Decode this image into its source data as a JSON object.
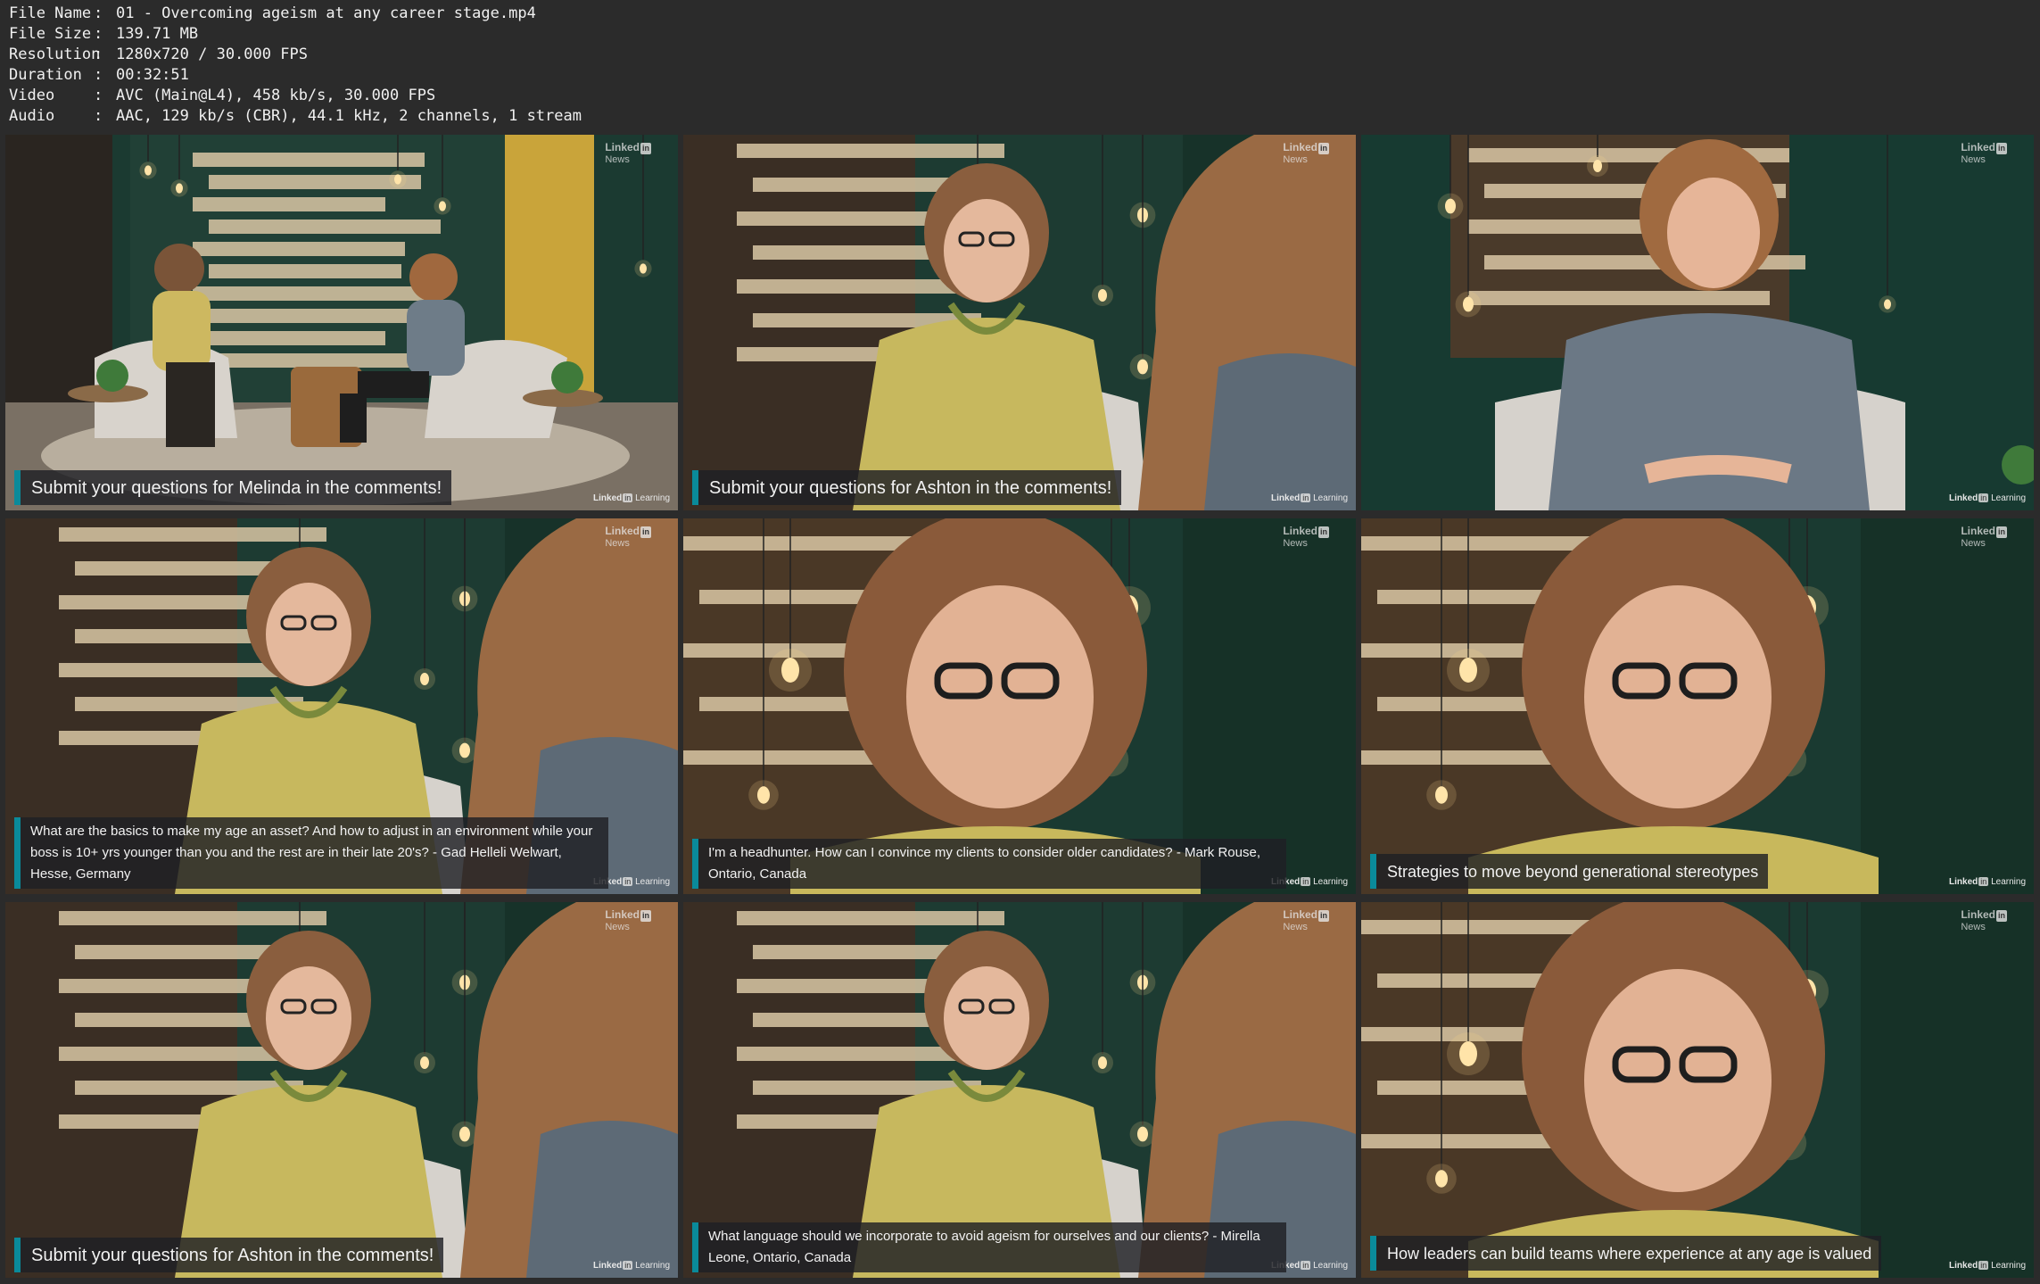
{
  "file_info": [
    {
      "key": "File Name",
      "value": "01 - Overcoming ageism at any career stage.mp4"
    },
    {
      "key": "File Size",
      "value": "139.71 MB"
    },
    {
      "key": "Resolution",
      "value": "1280x720 / 30.000 FPS"
    },
    {
      "key": "Duration",
      "value": "00:32:51"
    },
    {
      "key": "Video",
      "value": "AVC (Main@L4), 458 kb/s, 30.000 FPS"
    },
    {
      "key": "Audio",
      "value": "AAC, 129 kb/s (CBR), 44.1 kHz, 2 channels, 1 stream"
    }
  ],
  "logos": {
    "top_brand": "Linked",
    "top_badge": "in",
    "top_sub": "News",
    "bottom_brand": "Linked",
    "bottom_badge": "in",
    "bottom_sub": "Learning"
  },
  "frames": [
    {
      "scene": "wide",
      "caption": "Submit your questions for Melinda in the comments!",
      "caption_style": "big"
    },
    {
      "scene": "medium-over-shoulder",
      "caption": "Submit your questions for Ashton in the comments!",
      "caption_style": "big"
    },
    {
      "scene": "host-closeup",
      "caption": "",
      "caption_style": "none"
    },
    {
      "scene": "medium-over-shoulder",
      "caption": "What are the basics to make my age an asset? And how to adjust in an environment while your boss is 10+ yrs younger than you and the rest are in their late 20's? - Gad Helleli Welwart, Hesse, Germany",
      "caption_style": "small"
    },
    {
      "scene": "guest-closeup",
      "caption": "I'm a headhunter. How can I convince my clients to consider older candidates? - Mark Rouse, Ontario, Canada",
      "caption_style": "small"
    },
    {
      "scene": "guest-closeup",
      "caption": "Strategies to move beyond generational stereotypes",
      "caption_style": "medium"
    },
    {
      "scene": "medium-over-shoulder",
      "caption": "Submit your questions for Ashton in the comments!",
      "caption_style": "big"
    },
    {
      "scene": "medium-over-shoulder",
      "caption": "What language should we incorporate to avoid ageism for ourselves and our clients? - Mirella Leone, Ontario, Canada",
      "caption_style": "small"
    },
    {
      "scene": "guest-closeup",
      "caption": "How leaders can build teams where experience at any age is valued",
      "caption_style": "medium"
    }
  ],
  "colors": {
    "caption_accent": "#0a8a9a",
    "wall_green": "#1f3d33",
    "guest_top": "#c9b55a",
    "host_top": "#6d7a88"
  }
}
